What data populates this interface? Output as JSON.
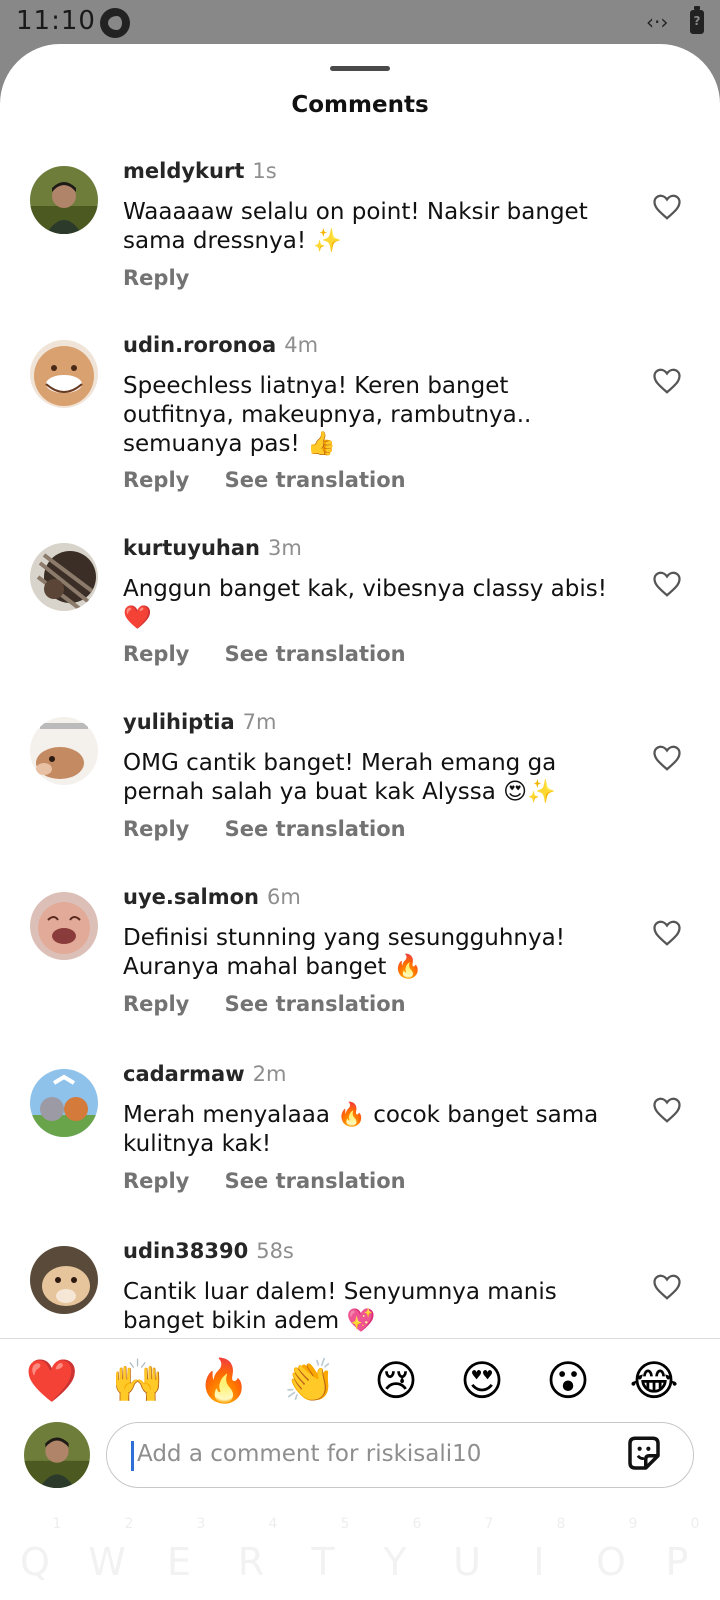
{
  "status_bar": {
    "time": "11:10",
    "data_icon": "‹·›",
    "battery_label": "?"
  },
  "sheet": {
    "title": "Comments"
  },
  "comments": [
    {
      "username": "meldykurt",
      "time": "1s",
      "text": "Waaaaaw selalu on point! Naksir banget sama dressnya! ✨",
      "reply": "Reply",
      "translation": ""
    },
    {
      "username": "udin.roronoa",
      "time": "4m",
      "text": "Speechless liatnya! Keren banget outfitnya, makeupnya, rambutnya.. semuanya pas! 👍",
      "reply": "Reply",
      "translation": "See translation"
    },
    {
      "username": "kurtuyuhan",
      "time": "3m",
      "text": "Anggun banget kak, vibesnya classy abis! ❤️",
      "reply": "Reply",
      "translation": "See translation"
    },
    {
      "username": "yulihiptia",
      "time": "7m",
      "text": "OMG cantik banget! Merah emang ga pernah salah ya buat kak Alyssa 😍✨",
      "reply": "Reply",
      "translation": "See translation"
    },
    {
      "username": "uye.salmon",
      "time": "6m",
      "text": "Definisi stunning yang sesungguhnya! Auranya mahal banget 🔥",
      "reply": "Reply",
      "translation": "See translation"
    },
    {
      "username": "cadarmaw",
      "time": "2m",
      "text": "Merah menyalaaa 🔥 cocok banget sama kulitnya kak!",
      "reply": "Reply",
      "translation": "See translation"
    },
    {
      "username": "udin38390",
      "time": "58s",
      "text": "Cantik luar dalem! Senyumnya manis banget bikin adem 💖",
      "reply": "",
      "translation": ""
    }
  ],
  "reactions": [
    "❤️",
    "🙌",
    "🔥",
    "👏",
    "😢",
    "😍",
    "😮",
    "😂"
  ],
  "composer": {
    "placeholder": "Add a comment for riskisali10"
  },
  "keyboard": {
    "keys": [
      "Q",
      "W",
      "E",
      "R",
      "T",
      "Y",
      "U",
      "I",
      "O",
      "P"
    ],
    "numbers": [
      "1",
      "2",
      "3",
      "4",
      "5",
      "6",
      "7",
      "8",
      "9",
      "0"
    ]
  }
}
